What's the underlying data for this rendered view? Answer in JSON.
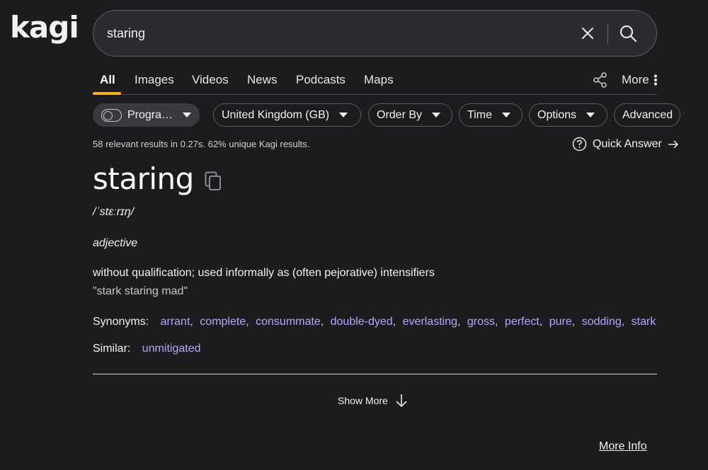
{
  "brand": {
    "logo_text": "kagi"
  },
  "search": {
    "query": "staring"
  },
  "tabs": [
    {
      "label": "All",
      "active": true
    },
    {
      "label": "Images"
    },
    {
      "label": "Videos"
    },
    {
      "label": "News"
    },
    {
      "label": "Podcasts"
    },
    {
      "label": "Maps"
    }
  ],
  "tabs_right": {
    "more_label": "More"
  },
  "filters": {
    "programming": "Progra…",
    "region": "United Kingdom (GB)",
    "order_by": "Order By",
    "time": "Time",
    "options": "Options",
    "advanced": "Advanced"
  },
  "stats": "58 relevant results in 0.27s. 62% unique Kagi results.",
  "quick_answer": "Quick Answer",
  "definition": {
    "word": "staring",
    "pronunciation": "/ˈstɛːrɪŋ/",
    "part_of_speech": "adjective",
    "meaning": "without qualification; used informally as (often pejorative) intensifiers",
    "example": "\"stark staring mad\"",
    "synonyms_label": "Synonyms:",
    "synonyms": [
      "arrant",
      "complete",
      "consummate",
      "double-dyed",
      "everlasting",
      "gross",
      "perfect",
      "pure",
      "sodding",
      "stark"
    ],
    "similar_label": "Similar:",
    "similar": [
      "unmitigated"
    ]
  },
  "show_more": "Show More",
  "more_info": "More Info",
  "colors": {
    "background": "#1c1c1e",
    "accent": "#f5b51f",
    "link": "#b4a8ff"
  }
}
